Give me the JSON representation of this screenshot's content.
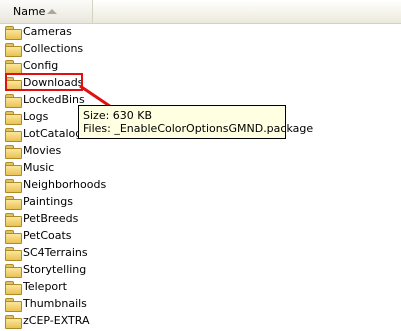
{
  "header": {
    "name_column": "Name"
  },
  "folders": [
    "Cameras",
    "Collections",
    "Config",
    "Downloads",
    "LockedBins",
    "Logs",
    "LotCatalog",
    "Movies",
    "Music",
    "Neighborhoods",
    "Paintings",
    "PetBreeds",
    "PetCoats",
    "SC4Terrains",
    "Storytelling",
    "Teleport",
    "Thumbnails",
    "zCEP-EXTRA"
  ],
  "tooltip": {
    "size_label": "Size:",
    "size_value": "630 KB",
    "files_label": "Files:",
    "files_value": "_EnableColorOptionsGMND.package"
  },
  "annotation": {
    "highlight_color": "#e01010",
    "arrow_color": "#e01010"
  }
}
